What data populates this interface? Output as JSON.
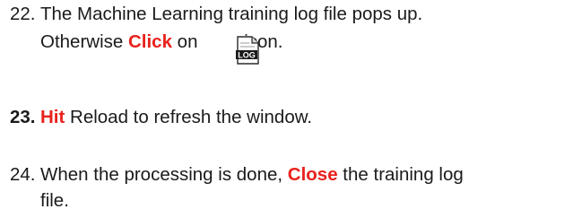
{
  "steps": [
    {
      "number": "22.",
      "line1": "The Machine Learning training log file pops up.",
      "line2_before": "Otherwise ",
      "keyword": "Click",
      "line2_mid": " on ",
      "line2_after": "icon."
    },
    {
      "number": "23.",
      "keyword": "Hit",
      "text": " Reload to refresh the window."
    },
    {
      "number": "24.",
      "line1_before": "When the processing is done, ",
      "keyword": "Close",
      "line1_after": " the training log",
      "line2": "file."
    }
  ],
  "icon": {
    "name": "log-file-icon",
    "label": "LOG"
  },
  "colors": {
    "keyword": "#e8221c",
    "text": "#1a1a1a"
  }
}
